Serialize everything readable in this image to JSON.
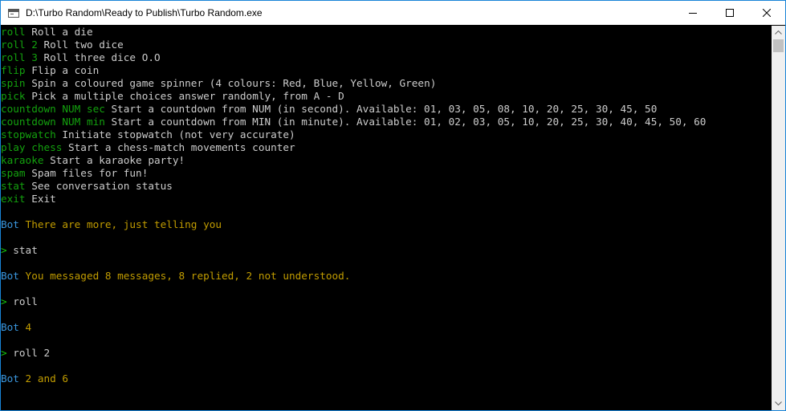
{
  "window": {
    "title": "D:\\Turbo Random\\Ready to Publish\\Turbo Random.exe"
  },
  "colors": {
    "command": "#13a10e",
    "bot_label": "#3a96dd",
    "bot_message": "#c19c00",
    "text": "#cccccc",
    "prompt": "#16c60c",
    "background": "#000000"
  },
  "console": {
    "help": [
      {
        "cmd": "roll",
        "desc": " Roll a die"
      },
      {
        "cmd": "roll 2",
        "desc": " Roll two dice"
      },
      {
        "cmd": "roll 3",
        "desc": " Roll three dice O.O"
      },
      {
        "cmd": "flip",
        "desc": " Flip a coin"
      },
      {
        "cmd": "spin",
        "desc": " Spin a coloured game spinner (4 colours: Red, Blue, Yellow, Green)"
      },
      {
        "cmd": "pick",
        "desc": " Pick a multiple choices answer randomly, from A - D"
      },
      {
        "cmd": "countdown NUM sec",
        "desc": " Start a countdown from NUM (in second). Available: 01, 03, 05, 08, 10, 20, 25, 30, 45, 50"
      },
      {
        "cmd": "countdown NUM min",
        "desc": " Start a countdown from MIN (in minute). Available: 01, 02, 03, 05, 10, 20, 25, 30, 40, 45, 50, 60"
      },
      {
        "cmd": "stopwatch",
        "desc": " Initiate stopwatch (not very accurate)"
      },
      {
        "cmd": "play chess",
        "desc": " Start a chess-match movements counter"
      },
      {
        "cmd": "karaoke",
        "desc": " Start a karaoke party!"
      },
      {
        "cmd": "spam",
        "desc": " Spam files for fun!"
      },
      {
        "cmd": "stat",
        "desc": " See conversation status"
      },
      {
        "cmd": "exit",
        "desc": " Exit"
      }
    ],
    "transcript": [
      {
        "kind": "blank"
      },
      {
        "kind": "bot",
        "label": "Bot",
        "text": " There are more, just telling you"
      },
      {
        "kind": "blank"
      },
      {
        "kind": "user",
        "prompt": ">",
        "text": " stat"
      },
      {
        "kind": "blank"
      },
      {
        "kind": "bot",
        "label": "Bot",
        "text": " You messaged 8 messages, 8 replied, 2 not understood."
      },
      {
        "kind": "blank"
      },
      {
        "kind": "user",
        "prompt": ">",
        "text": " roll"
      },
      {
        "kind": "blank"
      },
      {
        "kind": "bot",
        "label": "Bot",
        "text": " 4"
      },
      {
        "kind": "blank"
      },
      {
        "kind": "user",
        "prompt": ">",
        "text": " roll 2"
      },
      {
        "kind": "blank"
      },
      {
        "kind": "bot",
        "label": "Bot",
        "text": " 2 and 6"
      },
      {
        "kind": "blank"
      },
      {
        "kind": "blank"
      },
      {
        "kind": "user",
        "prompt": ">",
        "text": ""
      }
    ]
  },
  "icons": {
    "app": "console-window-icon",
    "minimize": "minimize-icon",
    "maximize": "maximize-icon",
    "close": "close-icon",
    "scroll_up": "scroll-up-arrow-icon",
    "scroll_down": "scroll-down-arrow-icon"
  }
}
